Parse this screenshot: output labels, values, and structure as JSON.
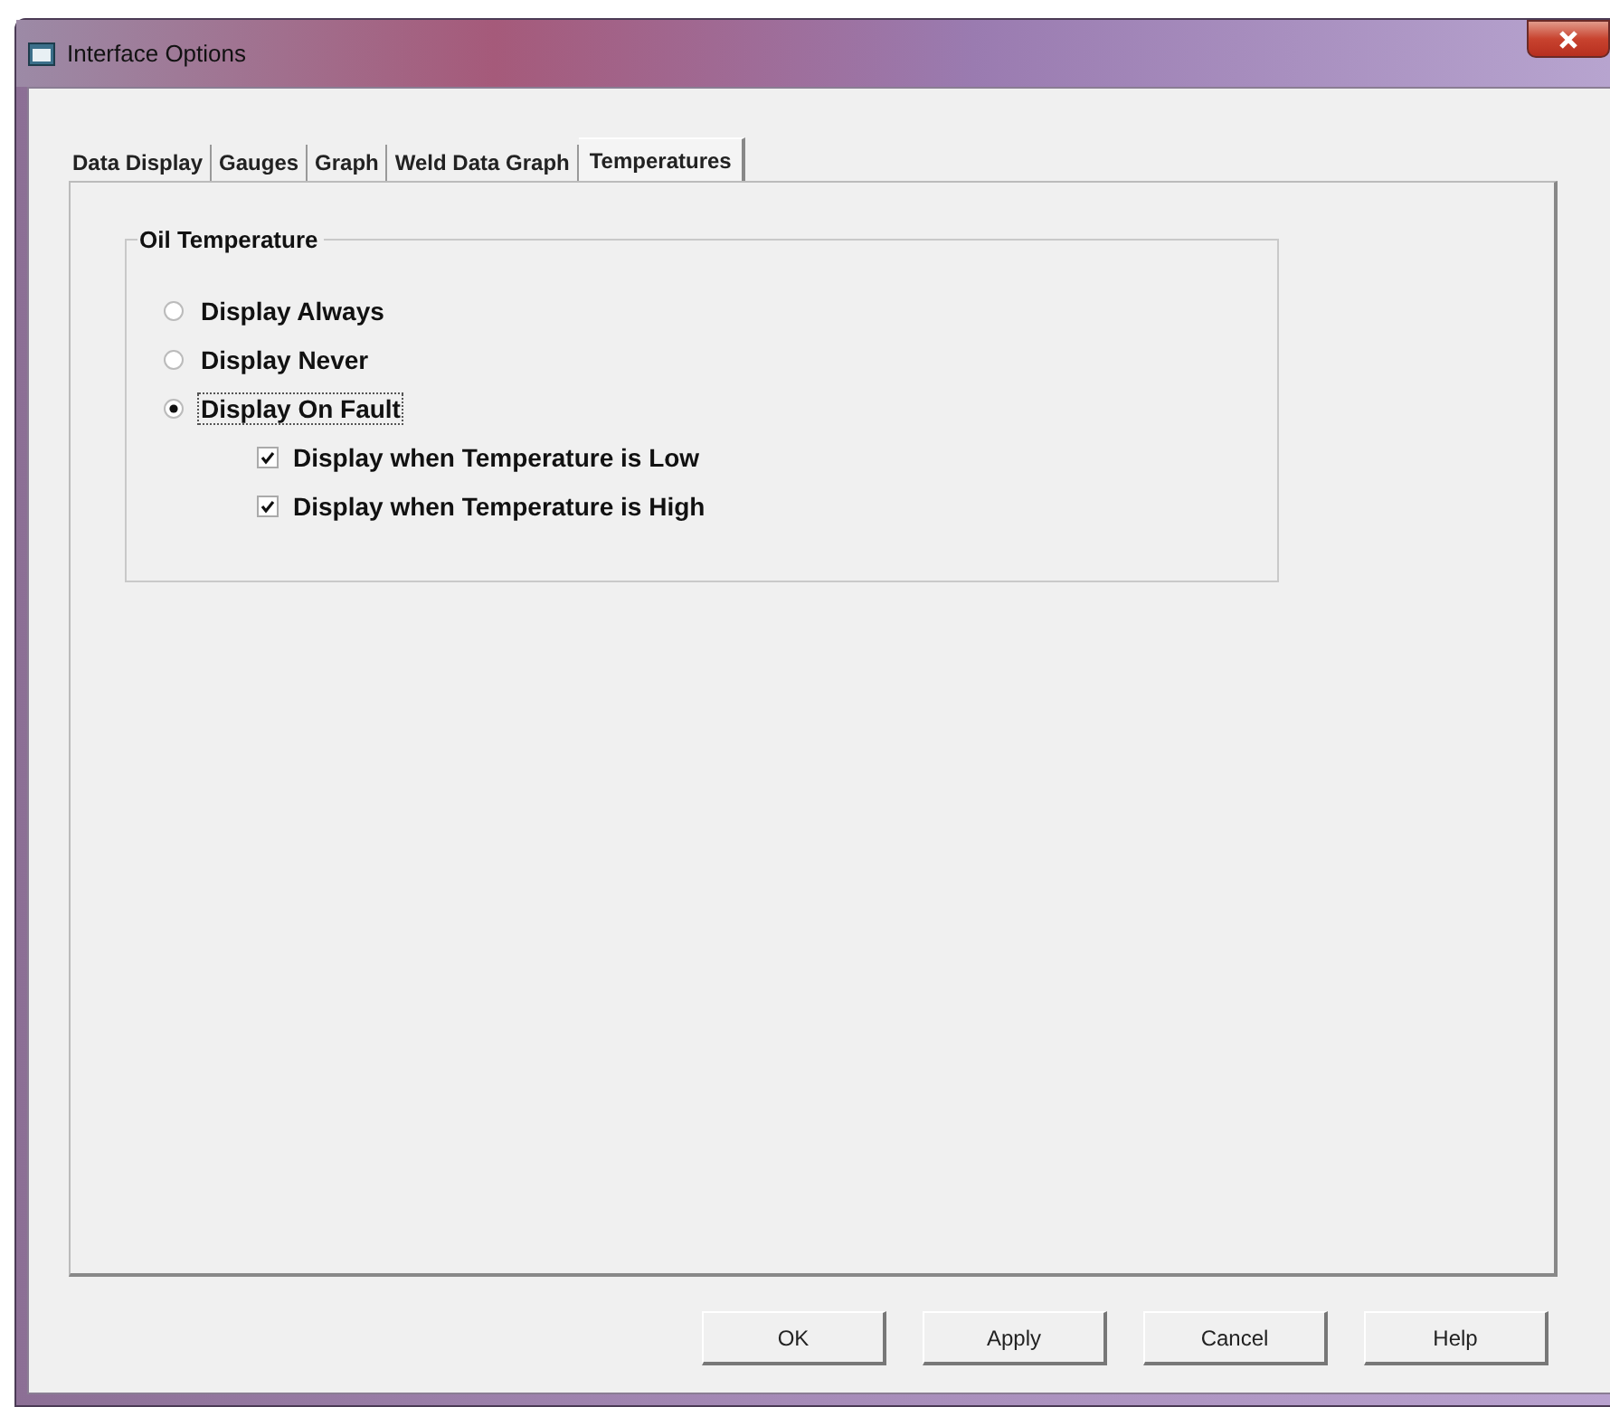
{
  "window": {
    "title": "Interface Options"
  },
  "tabs": [
    {
      "label": "Data Display",
      "selected": false
    },
    {
      "label": "Gauges",
      "selected": false
    },
    {
      "label": "Graph",
      "selected": false
    },
    {
      "label": "Weld Data Graph",
      "selected": false
    },
    {
      "label": "Temperatures",
      "selected": true
    }
  ],
  "group": {
    "title": "Oil Temperature",
    "options": [
      {
        "kind": "radio",
        "label": "Display Always",
        "selected": false
      },
      {
        "kind": "radio",
        "label": "Display Never",
        "selected": false
      },
      {
        "kind": "radio",
        "label": "Display On Fault",
        "selected": true,
        "children": [
          {
            "kind": "checkbox",
            "label": "Display when Temperature is Low",
            "checked": true
          },
          {
            "kind": "checkbox",
            "label": "Display when Temperature is High",
            "checked": true
          }
        ]
      }
    ]
  },
  "buttons": [
    "OK",
    "Apply",
    "Cancel",
    "Help"
  ]
}
